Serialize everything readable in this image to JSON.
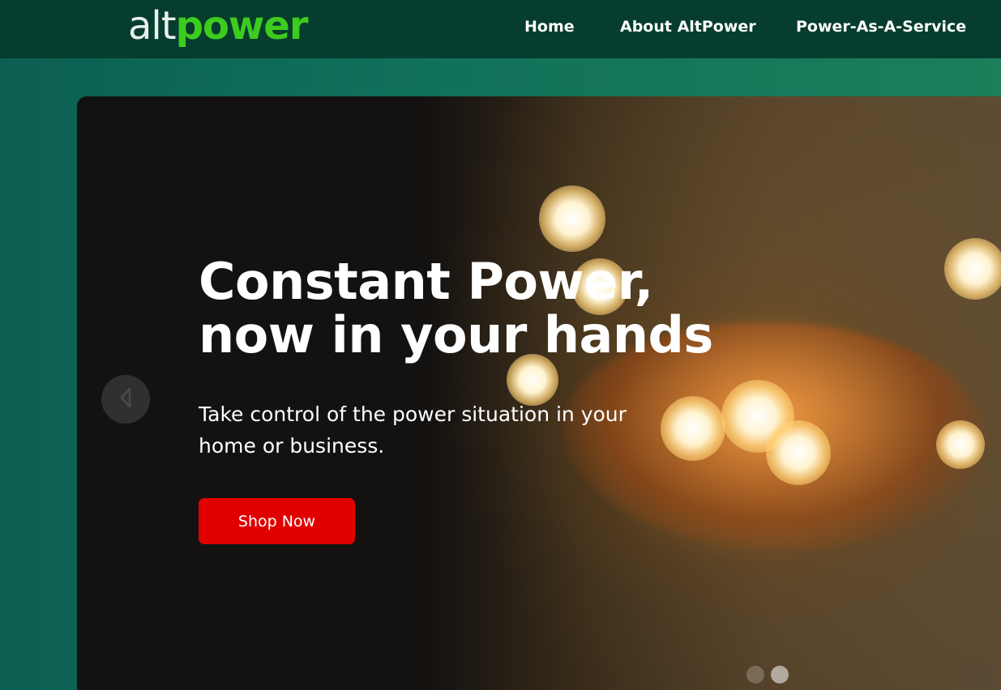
{
  "brand": {
    "logo_alt": "alt",
    "logo_power": "power"
  },
  "nav": {
    "items": [
      {
        "label": "Home"
      },
      {
        "label": "About AltPower"
      },
      {
        "label": "Power-As-A-Service"
      }
    ]
  },
  "hero": {
    "title_line1": "Constant Power,",
    "title_line2": "now in your hands",
    "subtitle_line1": "Take control of the power situation in your",
    "subtitle_line2": "home or business.",
    "cta_label": "Shop Now",
    "carousel": {
      "active_slide": 2,
      "slide_count": 2
    }
  },
  "colors": {
    "nav_bg": "#063d2e",
    "brand_green": "#3dcc1e",
    "cta_red": "#e10000",
    "page_bg": "#0b5f52"
  },
  "icons": {
    "prev": "chevron-left-icon"
  }
}
